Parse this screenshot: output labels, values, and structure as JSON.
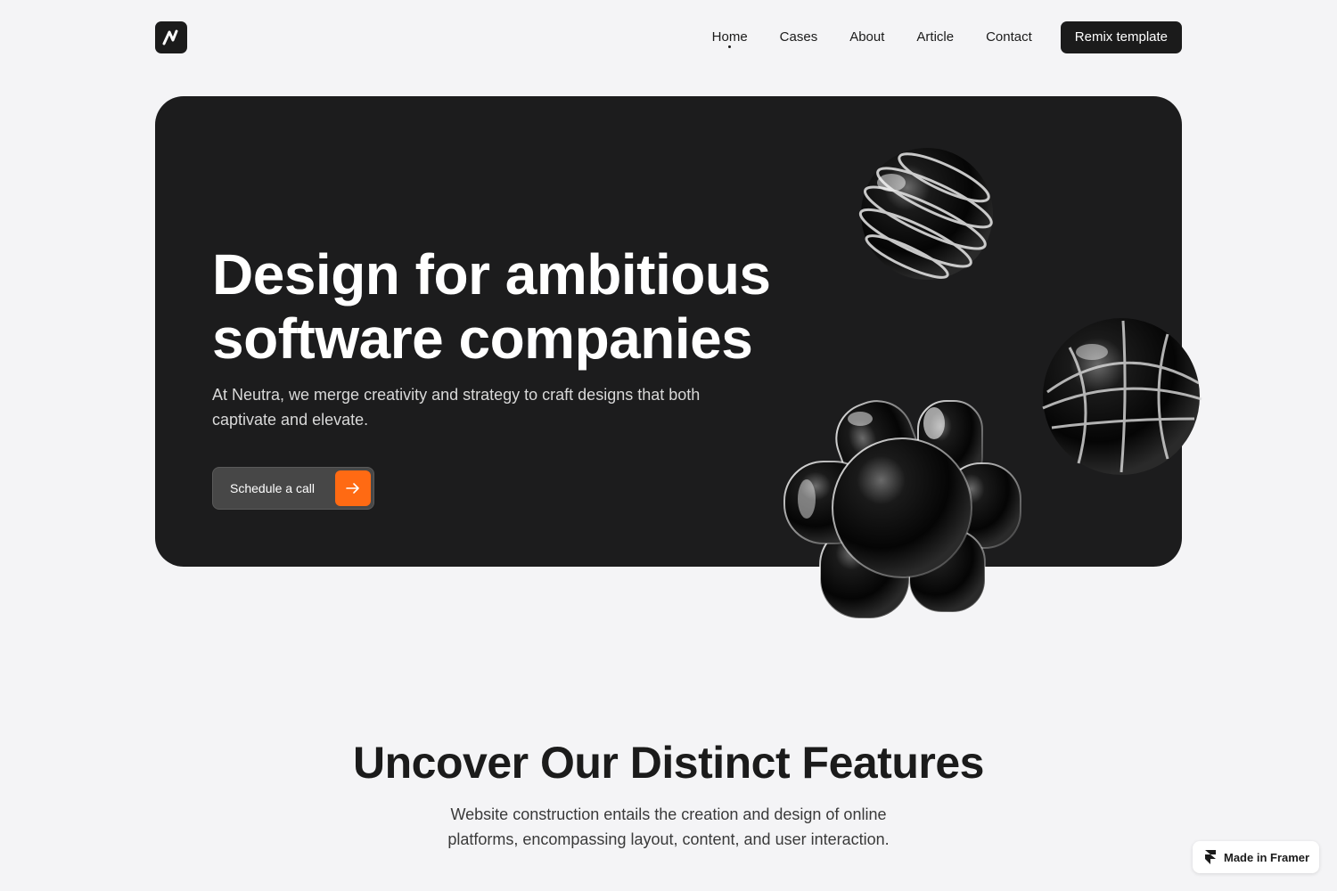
{
  "header": {
    "logo_icon": "neutra-logo-icon",
    "nav": [
      {
        "label": "Home",
        "active": true
      },
      {
        "label": "Cases",
        "active": false
      },
      {
        "label": "About",
        "active": false
      },
      {
        "label": "Article",
        "active": false
      },
      {
        "label": "Contact",
        "active": false
      }
    ],
    "cta_label": "Remix template"
  },
  "hero": {
    "title": "Design for ambitious software companies",
    "subtitle": "At Neutra, we merge creativity and strategy to craft designs that both captivate and elevate.",
    "button_label": "Schedule a call",
    "button_icon": "arrow-right-icon",
    "accent_color": "#ff6a13",
    "background_color": "#1c1c1d"
  },
  "features": {
    "title": "Uncover Our Distinct Features",
    "subtitle": "Website construction entails the creation and design of online platforms, encompassing layout, content, and user interaction."
  },
  "badge": {
    "label": "Made in Framer",
    "icon": "framer-icon"
  }
}
